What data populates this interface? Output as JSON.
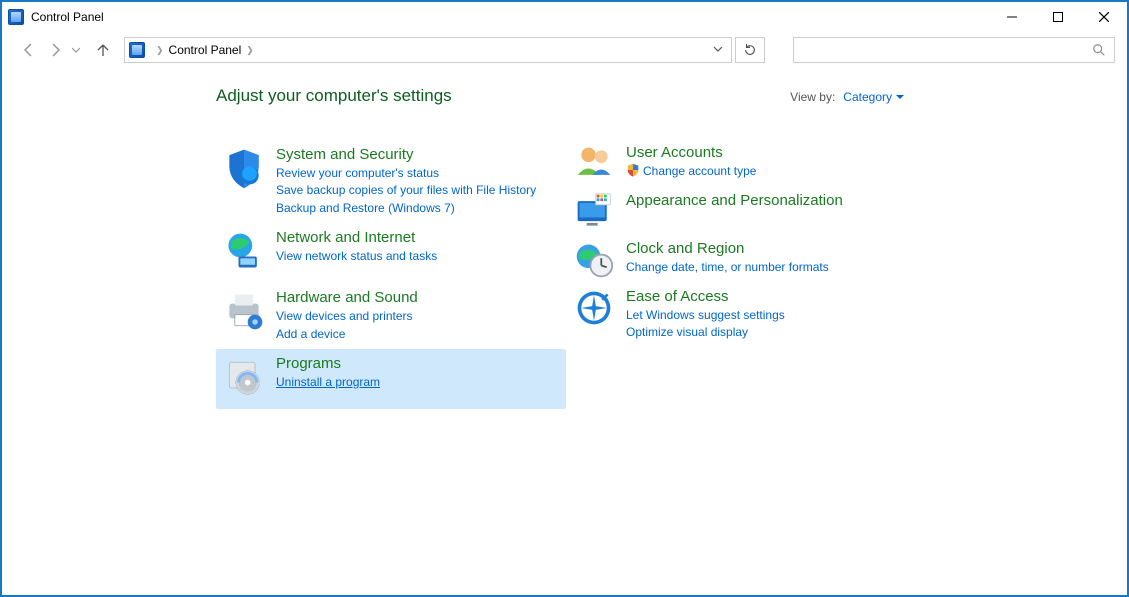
{
  "window": {
    "title": "Control Panel"
  },
  "address": {
    "root": "Control Panel"
  },
  "heading": "Adjust your computer's settings",
  "viewby": {
    "label": "View by:",
    "value": "Category"
  },
  "left": [
    {
      "title": "System and Security",
      "links": [
        "Review your computer's status",
        "Save backup copies of your files with File History",
        "Backup and Restore (Windows 7)"
      ]
    },
    {
      "title": "Network and Internet",
      "links": [
        "View network status and tasks"
      ]
    },
    {
      "title": "Hardware and Sound",
      "links": [
        "View devices and printers",
        "Add a device"
      ]
    },
    {
      "title": "Programs",
      "links": [
        "Uninstall a program"
      ]
    }
  ],
  "right": [
    {
      "title": "User Accounts",
      "links": [
        "Change account type"
      ],
      "shield": [
        true
      ]
    },
    {
      "title": "Appearance and Personalization",
      "links": []
    },
    {
      "title": "Clock and Region",
      "links": [
        "Change date, time, or number formats"
      ]
    },
    {
      "title": "Ease of Access",
      "links": [
        "Let Windows suggest settings",
        "Optimize visual display"
      ]
    }
  ]
}
